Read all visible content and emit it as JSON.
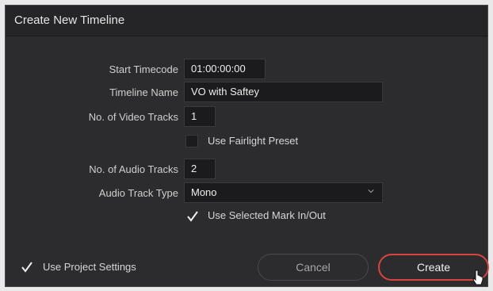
{
  "dialog": {
    "title": "Create New Timeline"
  },
  "form": {
    "start_timecode": {
      "label": "Start Timecode",
      "value": "01:00:00:00"
    },
    "timeline_name": {
      "label": "Timeline Name",
      "value": "VO with Saftey"
    },
    "video_tracks": {
      "label": "No. of Video Tracks",
      "value": "1"
    },
    "fairlight_preset": {
      "label": "Use Fairlight Preset",
      "checked": false
    },
    "audio_tracks": {
      "label": "No. of Audio Tracks",
      "value": "2"
    },
    "audio_track_type": {
      "label": "Audio Track Type",
      "value": "Mono"
    },
    "selected_mark": {
      "label": "Use Selected Mark In/Out",
      "checked": true
    }
  },
  "footer": {
    "project_settings": {
      "label": "Use Project Settings",
      "checked": true
    },
    "cancel_label": "Cancel",
    "create_label": "Create"
  },
  "colors": {
    "accent": "#d9443f",
    "background": "#2c2c2e",
    "field": "#1b1b1d"
  },
  "icons": {
    "checkmark": "checkmark-icon",
    "dropdown": "chevron-down-icon",
    "cursor": "pointer-cursor-icon"
  }
}
